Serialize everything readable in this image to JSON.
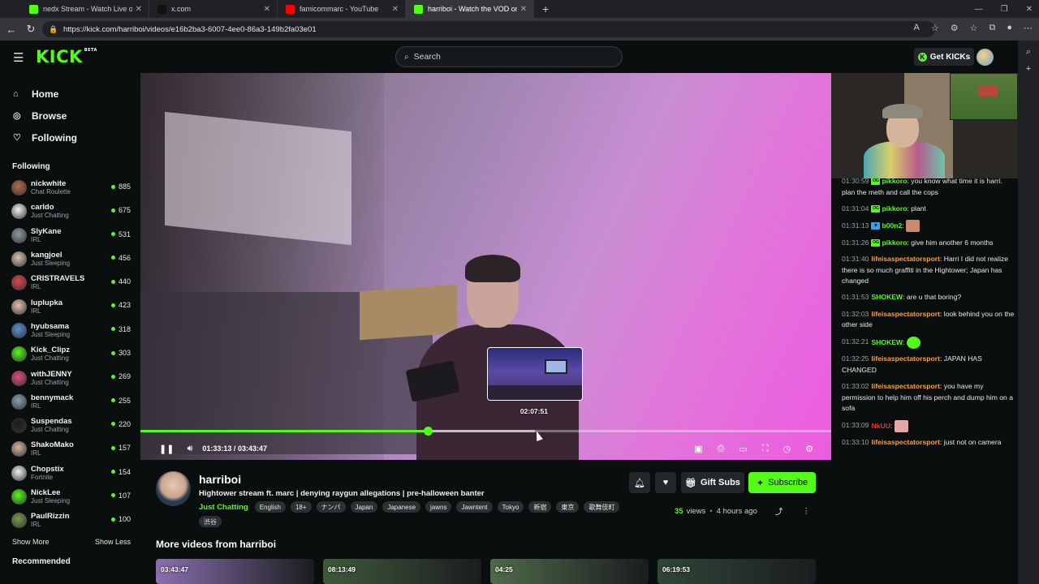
{
  "browser": {
    "tabs": [
      {
        "title": "nedx Stream - Watch Live on",
        "favicon": "#53fc18",
        "active": false
      },
      {
        "title": "x.com",
        "favicon": "#111111",
        "active": false
      },
      {
        "title": "famicommarc - YouTube",
        "favicon": "#ff0000",
        "active": false
      },
      {
        "title": "harriboi - Watch the VOD on",
        "favicon": "#53fc18",
        "active": true
      }
    ],
    "url": "https://kick.com/harriboi/videos/e16b2ba3-6007-4ee0-86a3-149b2fa03e01"
  },
  "header": {
    "logo": "KICK",
    "logo_badge": "BETA",
    "search_placeholder": "Search",
    "get_kicks_label": "Get KICKs"
  },
  "sidebar": {
    "nav": [
      {
        "label": "Home",
        "icon": "home-icon"
      },
      {
        "label": "Browse",
        "icon": "compass-icon"
      },
      {
        "label": "Following",
        "icon": "heart-icon"
      }
    ],
    "following_heading": "Following",
    "following": [
      {
        "name": "nickwhite",
        "category": "Chat Roulette",
        "viewers": "885",
        "color": "#b5684a"
      },
      {
        "name": "carldo",
        "category": "Just Chatting",
        "viewers": "675",
        "color": "#f2f2f2"
      },
      {
        "name": "SlyKane",
        "category": "IRL",
        "viewers": "531",
        "color": "#8c9a9c"
      },
      {
        "name": "kangjoel",
        "category": "Just Sleeping",
        "viewers": "456",
        "color": "#d8c3b2"
      },
      {
        "name": "CRISTRAVELS",
        "category": "IRL",
        "viewers": "440",
        "color": "#d9474a"
      },
      {
        "name": "luplupka",
        "category": "IRL",
        "viewers": "423",
        "color": "#e7c1b0"
      },
      {
        "name": "hyubsama",
        "category": "Just Sleeping",
        "viewers": "318",
        "color": "#5b8fd6"
      },
      {
        "name": "Kick_Clipz",
        "category": "Just Chatting",
        "viewers": "303",
        "color": "#53fc18"
      },
      {
        "name": "withJENNY",
        "category": "Just Chatting",
        "viewers": "269",
        "color": "#e24a7e"
      },
      {
        "name": "bennymack",
        "category": "IRL",
        "viewers": "255",
        "color": "#8aa0b4"
      },
      {
        "name": "Suspendas",
        "category": "Just Chatting",
        "viewers": "220",
        "color": "#1c1c1c"
      },
      {
        "name": "ShakoMako",
        "category": "IRL",
        "viewers": "157",
        "color": "#d6b5a2"
      },
      {
        "name": "Chopstix",
        "category": "Fortnite",
        "viewers": "154",
        "color": "#f0f0f0"
      },
      {
        "name": "NickLee",
        "category": "Just Sleeping",
        "viewers": "107",
        "color": "#53fc18"
      },
      {
        "name": "PaulRizzin",
        "category": "IRL",
        "viewers": "100",
        "color": "#7a9a4a"
      }
    ],
    "show_more": "Show More",
    "show_less": "Show Less",
    "recommended_heading": "Recommended"
  },
  "player": {
    "current_time": "01:33:13",
    "separator": "/",
    "duration": "03:43:47",
    "played_fraction": 0.416,
    "hover_fraction": 0.571,
    "preview_time": "02:07:51"
  },
  "chat": {
    "messages": [
      {
        "time": "01:30:59",
        "user": "pikkoro",
        "badge": "OG",
        "color": "#53fc18",
        "text": "you know what time it is harri. plan the meth and call the cops"
      },
      {
        "time": "01:31:04",
        "user": "pikkoro",
        "badge": "OG",
        "color": "#53fc18",
        "text": "plant"
      },
      {
        "time": "01:31:13",
        "user": "b00n2",
        "badge": "B",
        "color": "#53fc18",
        "text": "",
        "emote": "#c98b6b"
      },
      {
        "time": "01:31:26",
        "user": "pikkoro",
        "badge": "OG",
        "color": "#53fc18",
        "text": "give him another 6 months"
      },
      {
        "time": "01:31:40",
        "user": "lifeisaspectatorsport",
        "badge": "",
        "color": "#ff9d3a",
        "text": "Harri I did not realize there is so much graffiti in the Hightower; Japan has changed"
      },
      {
        "time": "01:31:53",
        "user": "SHOKEW",
        "badge": "",
        "color": "#53fc18",
        "text": "are u that boring?"
      },
      {
        "time": "01:32:03",
        "user": "lifeisaspectatorsport",
        "badge": "",
        "color": "#ff9d3a",
        "text": "look behind you on the other side"
      },
      {
        "time": "01:32:21",
        "user": "SHOKEW",
        "badge": "",
        "color": "#53fc18",
        "text": "",
        "emote": "#53fc18"
      },
      {
        "time": "01:32:25",
        "user": "lifeisaspectatorsport",
        "badge": "",
        "color": "#ff9d3a",
        "text": "JAPAN HAS CHANGED"
      },
      {
        "time": "01:33:02",
        "user": "lifeisaspectatorsport",
        "badge": "",
        "color": "#ff9d3a",
        "text": "you have my permission to help him off his perch and dump him on a sofa"
      },
      {
        "time": "01:33:09",
        "user": "NkUU",
        "badge": "",
        "color": "#e2363a",
        "text": "",
        "emote": "#e0a8a8"
      },
      {
        "time": "01:33:10",
        "user": "lifeisaspectatorsport",
        "badge": "",
        "color": "#ff9d3a",
        "text": "just not on camera"
      }
    ]
  },
  "info": {
    "channel": "harriboi",
    "title": "Hightower stream ft. marc | denying raygun allegations | pre-halloween banter",
    "category": "Just Chatting",
    "tags": [
      "English",
      "18+",
      "ナンパ",
      "Japan",
      "Japanese",
      "jawns",
      "Jawntent",
      "Tokyo",
      "新宿",
      "東京",
      "歌舞伎町",
      "渋谷"
    ],
    "gift_label": "Gift Subs",
    "subscribe_label": "Subscribe",
    "views_count": "35",
    "views_label": "views",
    "dot": "•",
    "ago": "4 hours ago",
    "more_heading": "More videos from harriboi",
    "videos": [
      {
        "duration": "03:43:47",
        "color": "#8a6fb0"
      },
      {
        "duration": "08:13:49",
        "color": "#3f5a3a"
      },
      {
        "duration": "04:25",
        "color": "#4f6a4a"
      },
      {
        "duration": "06:19:53",
        "color": "#2f4638"
      }
    ]
  },
  "colors": {
    "brand": "#53fc18",
    "bg": "#0b0e0f"
  }
}
